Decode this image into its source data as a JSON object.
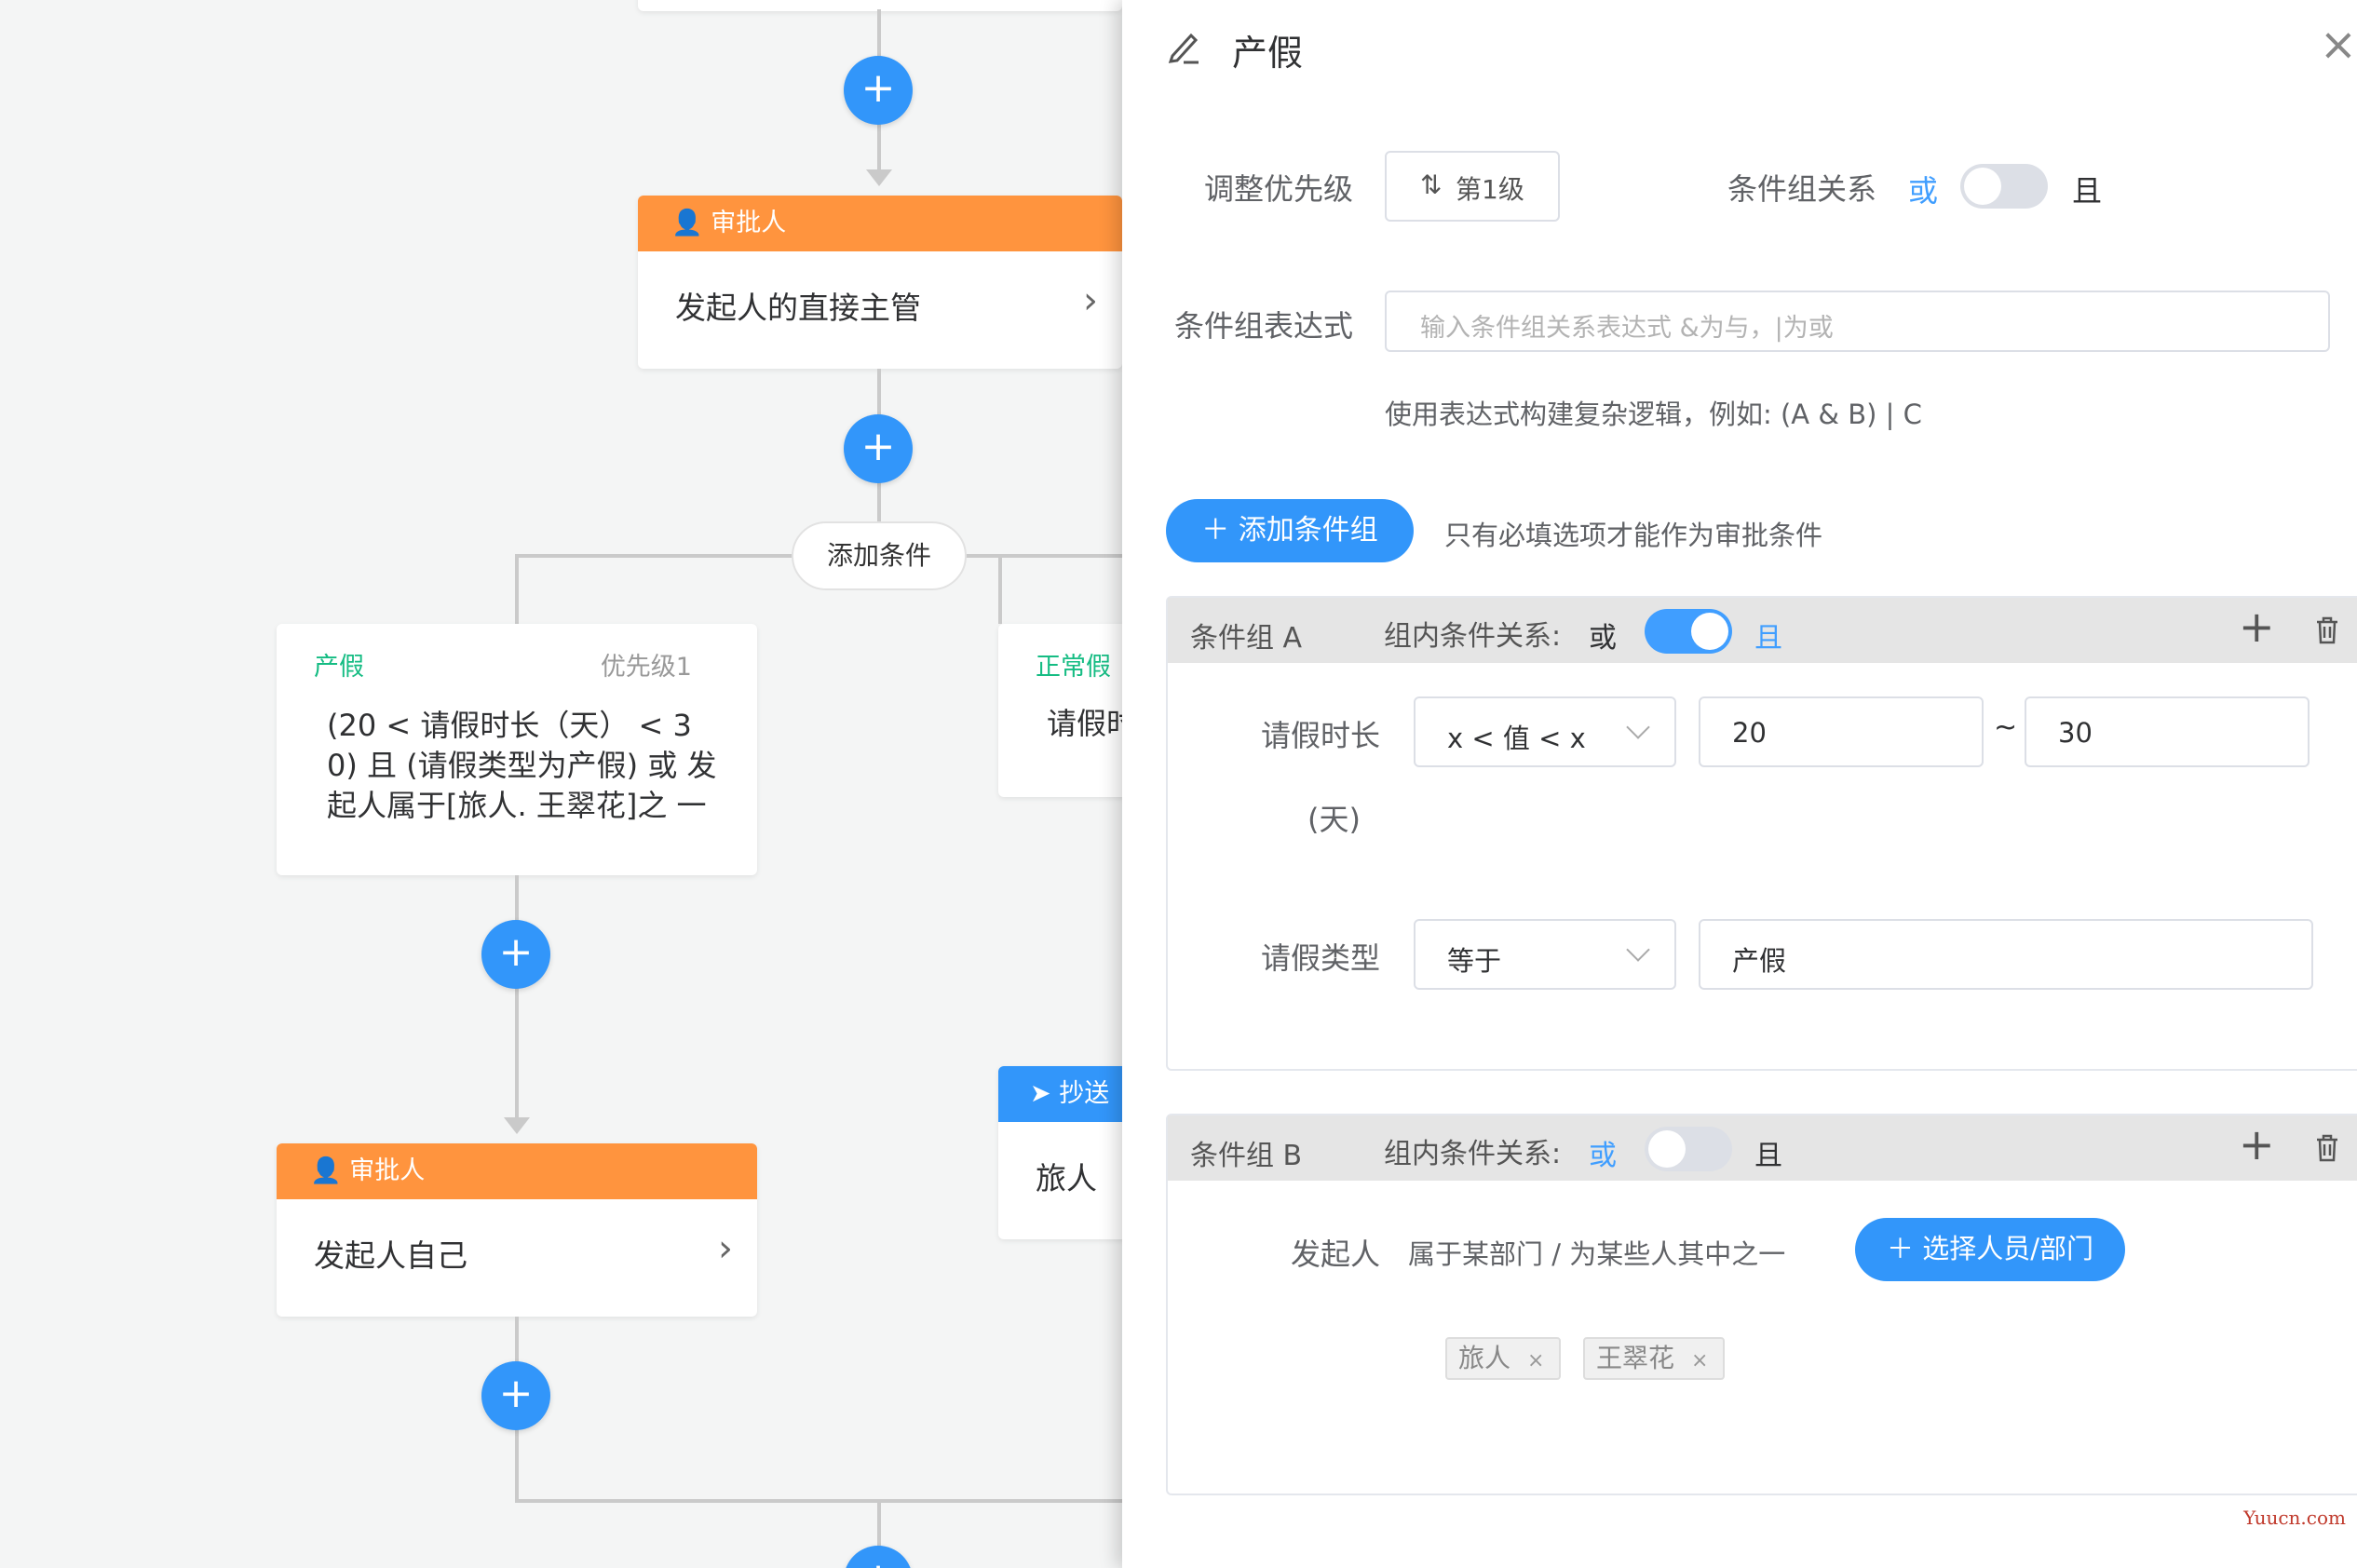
{
  "flow": {
    "approver1": {
      "head": "审批人",
      "body": "发起人的直接主管"
    },
    "add_condition": "添加条件",
    "cond_left": {
      "title": "产假",
      "priority": "优先级1",
      "text": "(20 < 请假时长（天） < 3 0) 且 (请假类型为产假) 或 发起人属于[旅人. 王翠花]之 一"
    },
    "cond_right": {
      "title": "正常假",
      "text": "请假时"
    },
    "approver2": {
      "head": "审批人",
      "body": "发起人自己"
    },
    "cc": {
      "head": "抄送",
      "body": "旅人"
    },
    "plus": "+"
  },
  "drawer": {
    "title": "产假",
    "close": "×",
    "priority_label": "调整优先级",
    "priority_value": "第1级",
    "priority_icon": "⇅",
    "group_relation_label": "条件组关系",
    "rel_or": "或",
    "rel_and": "且",
    "expr_label": "条件组表达式",
    "expr_placeholder": "输入条件组关系表达式 &为与，|为或",
    "expr_hint": "使用表达式构建复杂逻辑，例如: (A & B) | C",
    "add_group_btn": "＋  添加条件组",
    "add_group_hint": "只有必填选项才能作为审批条件",
    "groupA": {
      "title": "条件组 A",
      "relation_label": "组内条件关系:",
      "or": "或",
      "and": "且",
      "row1": {
        "label1": "请假时长",
        "label2": "(天)",
        "op": "x < 值 < x",
        "v1": "20",
        "sep": "~",
        "v2": "30"
      },
      "row2": {
        "label": "请假类型",
        "op": "等于",
        "value": "产假"
      }
    },
    "groupB": {
      "title": "条件组 B",
      "relation_label": "组内条件关系:",
      "or": "或",
      "and": "且",
      "label": "发起人",
      "desc": "属于某部门 / 为某些人其中之一",
      "select_btn": "＋ 选择人员/部门",
      "tags": [
        "旅人",
        "王翠花"
      ],
      "tag_close": "×"
    },
    "plus": "+"
  },
  "watermark": "Yuucn.com",
  "colors": {
    "primary": "#3296fa",
    "orange": "#ff943e",
    "green": "#15bc83"
  }
}
